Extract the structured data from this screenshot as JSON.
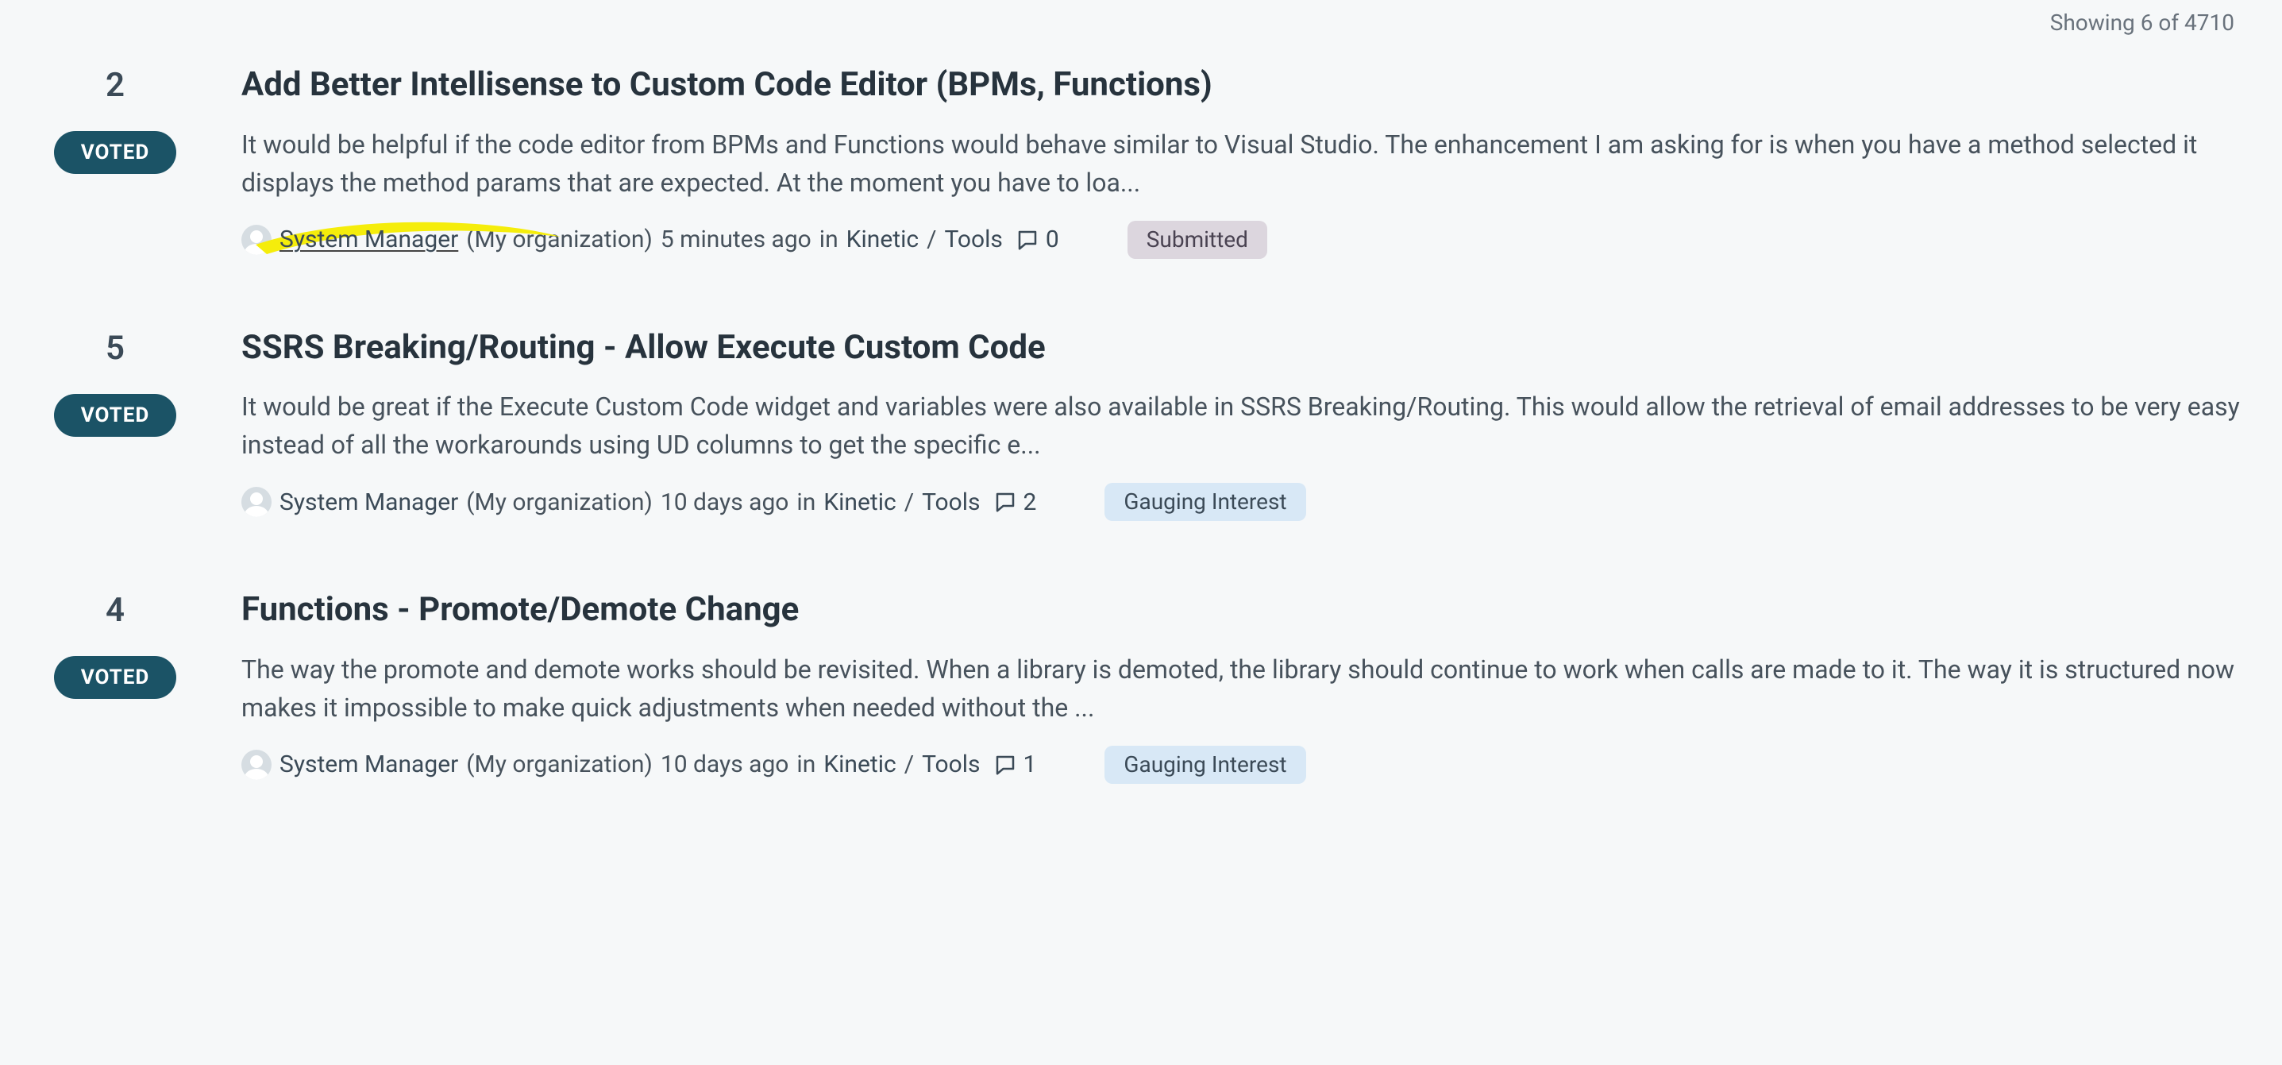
{
  "header": {
    "showing_text": "Showing 6 of 4710"
  },
  "voted_label": "VOTED",
  "ideas": [
    {
      "votes": "2",
      "title": "Add Better Intellisense to Custom Code Editor (BPMs, Functions)",
      "description": "It would be helpful if the code editor from BPMs and Functions would behave similar to Visual Studio. The enhancement I am asking for is when you have a method selected it displays the method params that are expected. At the moment you have to loa...",
      "author": "System Manager",
      "org": "(My organization)",
      "ago": "5 minutes ago",
      "in_label": "in ",
      "cat1": "Kinetic",
      "sep": " / ",
      "cat2": "Tools",
      "comments": "0",
      "status": "Submitted",
      "status_class": "status-submitted",
      "highlight": true
    },
    {
      "votes": "5",
      "title": "SSRS Breaking/Routing - Allow Execute Custom Code",
      "description": "It would be great if the Execute Custom Code widget and variables were also available in SSRS Breaking/Routing. This would allow the retrieval of email addresses to be very easy instead of all the workarounds using UD columns to get the specific e...",
      "author": "System Manager",
      "org": "(My organization)",
      "ago": "10 days ago",
      "in_label": "in ",
      "cat1": "Kinetic",
      "sep": " / ",
      "cat2": "Tools",
      "comments": "2",
      "status": "Gauging Interest",
      "status_class": "status-gauging",
      "highlight": false
    },
    {
      "votes": "4",
      "title": "Functions - Promote/Demote Change",
      "description": "The way the promote and demote works should be revisited. When a library is demoted, the library should continue to work when calls are made to it. The way it is structured now makes it impossible to make quick adjustments when needed without the ...",
      "author": "System Manager",
      "org": "(My organization)",
      "ago": "10 days ago",
      "in_label": "in ",
      "cat1": "Kinetic",
      "sep": " / ",
      "cat2": "Tools",
      "comments": "1",
      "status": "Gauging Interest",
      "status_class": "status-gauging",
      "highlight": false
    }
  ]
}
